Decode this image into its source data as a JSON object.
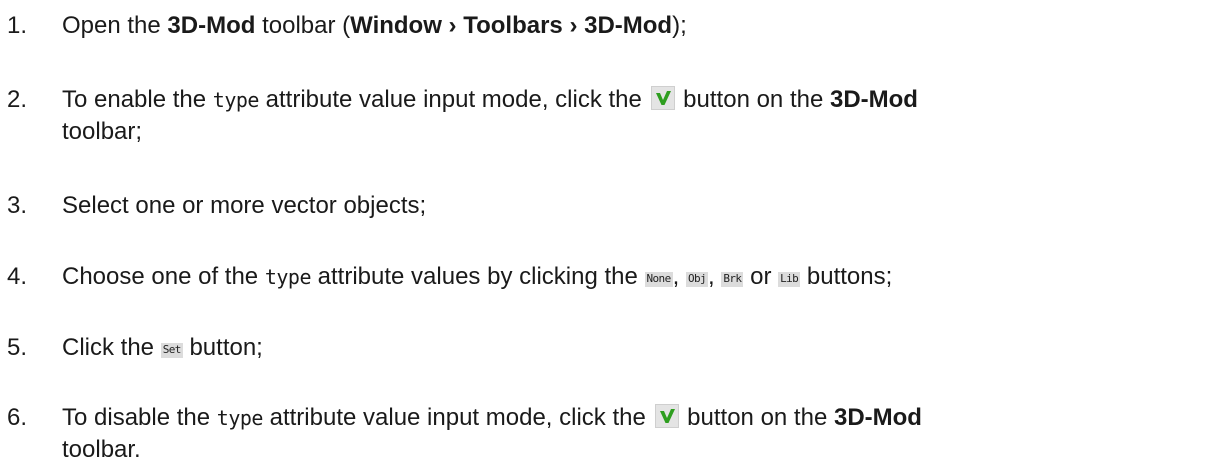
{
  "steps": [
    {
      "num": "1.",
      "t1": "Open the ",
      "b1": "3D-Mod",
      "t2": " toolbar (",
      "b2": "Window › Toolbars › 3D-Mod",
      "t3": ");"
    },
    {
      "num": "2.",
      "t1": "To enable the ",
      "code": "type",
      "t2": " attribute value input mode, click the ",
      "t3": " button on the ",
      "b1": "3D-Mod",
      "t4": "toolbar;"
    },
    {
      "num": "3.",
      "t1": "Select one or more vector objects;"
    },
    {
      "num": "4.",
      "t1": "Choose one of the ",
      "code": "type",
      "t2": " attribute values by clicking the ",
      "btn_none": "None",
      "sep1": ", ",
      "btn_obj": "Obj",
      "sep2": ", ",
      "btn_brk": "Brk",
      "sep3": " or ",
      "btn_lib": "Lib",
      "t3": " buttons;"
    },
    {
      "num": "5.",
      "t1": "Click the ",
      "btn_set": "Set",
      "t2": " button;"
    },
    {
      "num": "6.",
      "t1": "To disable the ",
      "code": "type",
      "t2": " attribute value input mode, click the ",
      "t3": " button on the ",
      "b1": "3D-Mod",
      "t4": "toolbar."
    }
  ],
  "icons": {
    "check": "checkmark-icon",
    "check_color": "#2e9e1f"
  }
}
